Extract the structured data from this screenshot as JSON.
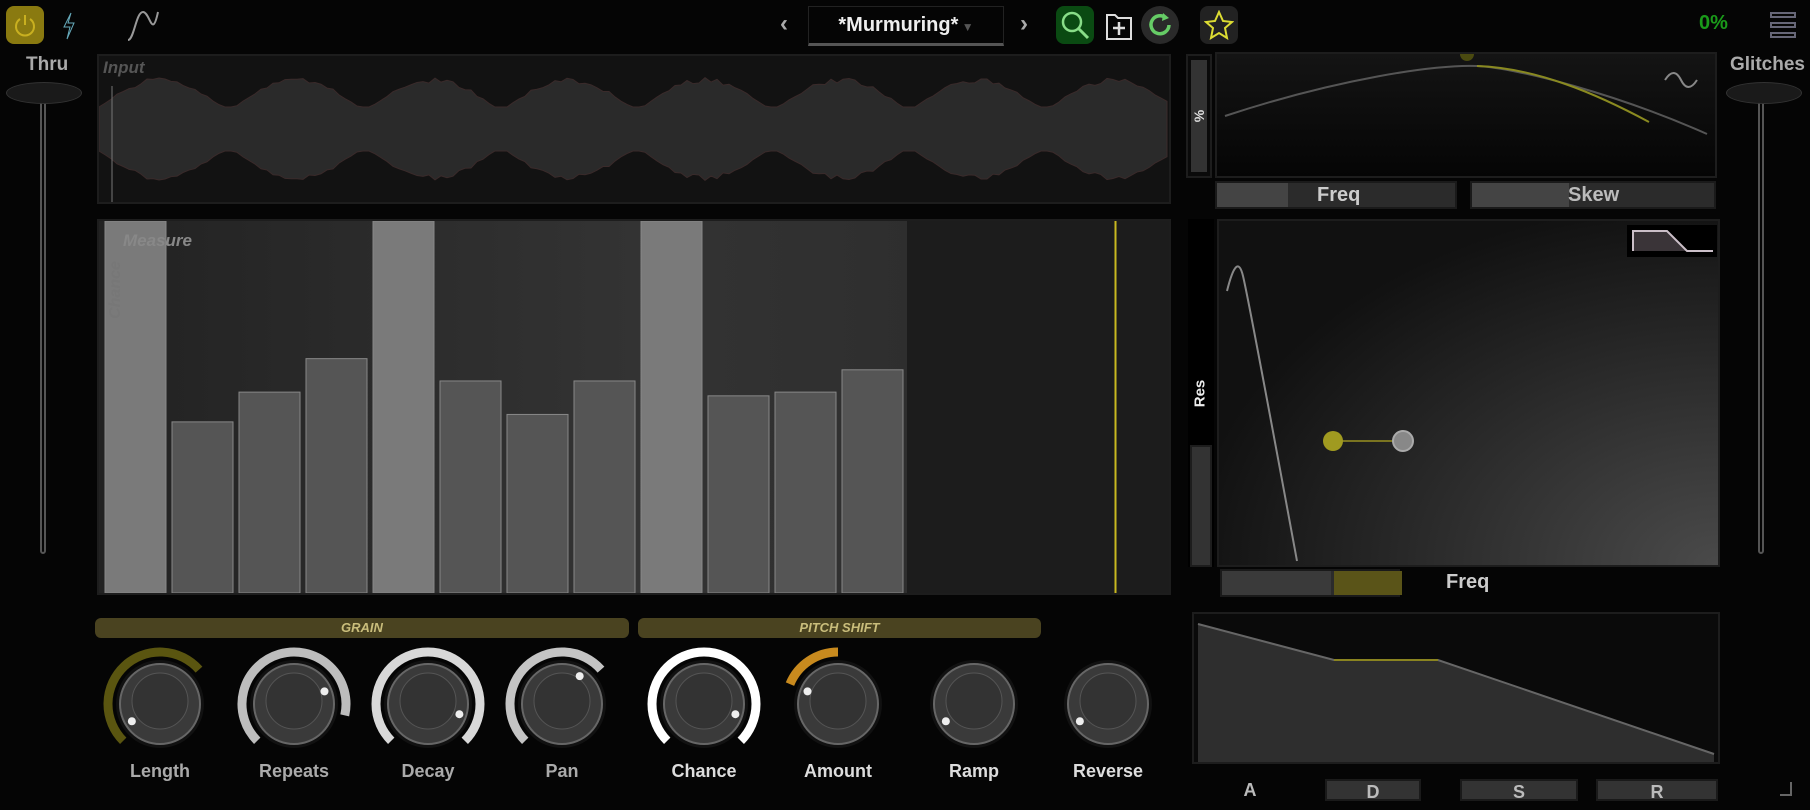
{
  "toolbar": {
    "preset_name": "*Murmuring*",
    "prev": "‹",
    "next": "›",
    "cpu": "0%",
    "icons": [
      "power-icon",
      "bolt-icon",
      "sine-wave-icon",
      "search-icon",
      "add-preset-icon",
      "refresh-icon",
      "star-icon",
      "menu-icon"
    ]
  },
  "left": {
    "thru_label": "Thru"
  },
  "right": {
    "glitches_label": "Glitches"
  },
  "input": {
    "label": "Input"
  },
  "measure": {
    "label": "Measure",
    "y_label": "Chance",
    "bars": [
      1.0,
      0.46,
      0.54,
      0.63,
      1.0,
      0.57,
      0.48,
      0.57,
      1.0,
      0.53,
      0.54,
      0.6
    ],
    "total_slots": 16,
    "playhead": 0.95
  },
  "sections": {
    "grain": "GRAIN",
    "pitch": "PITCH SHIFT"
  },
  "knobs": [
    {
      "label": "Length",
      "from": 0,
      "to": 0.68,
      "color": "#5a5510",
      "value": 0.05
    },
    {
      "label": "Repeats",
      "from": 0,
      "to": 0.88,
      "color": "#bdbdbd",
      "value": 0.75
    },
    {
      "label": "Decay",
      "from": 0,
      "to": 1.0,
      "color": "#d8d8d8",
      "value": 0.9
    },
    {
      "label": "Pan",
      "from": 0,
      "to": 0.68,
      "color": "#c4c4c4",
      "value": 0.62
    },
    {
      "label": "Chance",
      "from": 0,
      "to": 1.0,
      "color": "#ffffff",
      "value": 0.9
    },
    {
      "label": "Amount",
      "from": 0.25,
      "to": 0.5,
      "color": "#c88a1e",
      "value": 0.25
    },
    {
      "label": "Ramp",
      "from": 0,
      "to": 0,
      "color": "#888",
      "value": 0.05
    },
    {
      "label": "Reverse",
      "from": 0,
      "to": 0,
      "color": "#888",
      "value": 0.05
    }
  ],
  "lfo": {
    "y_label": "%",
    "freq": "Freq",
    "skew": "Skew",
    "freq_value": 0.3,
    "skew_value": 0.4
  },
  "filter": {
    "res_label": "Res",
    "freq_label": "Freq",
    "freq_value": 0.62,
    "res_value": 0.35
  },
  "adsr": {
    "a": "A",
    "d": "D",
    "s": "S",
    "r": "R"
  },
  "colors": {
    "accent": "#b8b030",
    "green": "#1a8a1a"
  }
}
